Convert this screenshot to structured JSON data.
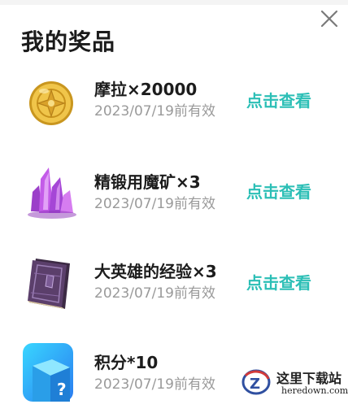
{
  "dialog": {
    "title": "我的奖品"
  },
  "prizes": [
    {
      "name": "摩拉×20000",
      "expiry": "2023/07/19前有效",
      "action": "点击查看",
      "icon": "mora-coin-icon"
    },
    {
      "name": "精锻用魔矿×3",
      "expiry": "2023/07/19前有效",
      "action": "点击查看",
      "icon": "mystic-crystal-icon"
    },
    {
      "name": "大英雄的经验×3",
      "expiry": "2023/07/19前有效",
      "action": "点击查看",
      "icon": "exp-book-icon"
    },
    {
      "name": "积分*10",
      "expiry": "2023/07/19前有效",
      "action": "",
      "icon": "points-box-icon"
    }
  ],
  "watermark": {
    "cn": "这里下载站",
    "en": "heredown.com"
  },
  "colors": {
    "accent": "#2cbfb6",
    "title": "#1b1b1b",
    "muted": "#9a9a9a"
  }
}
